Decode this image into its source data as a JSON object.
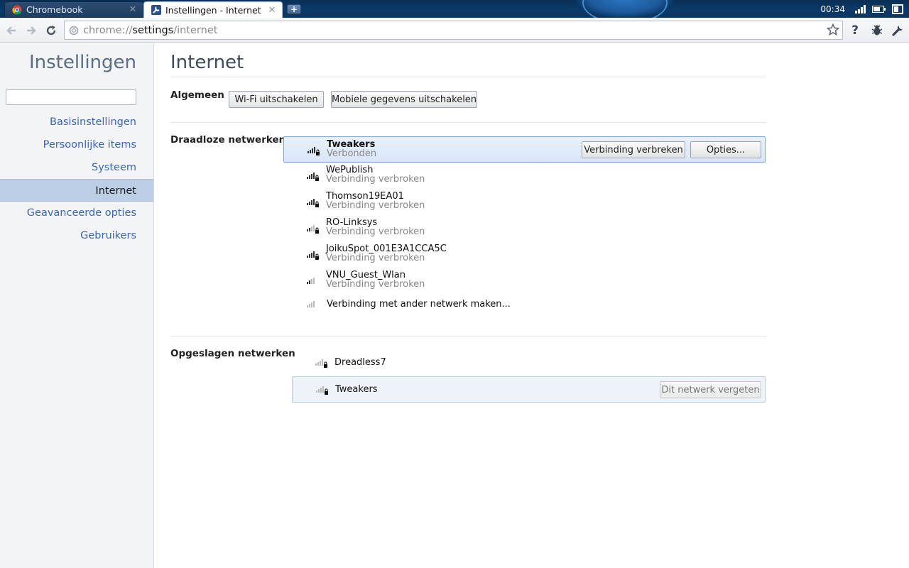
{
  "tabs": [
    {
      "title": "Chromebook",
      "active": false
    },
    {
      "title": "Instellingen - Internet",
      "active": true
    }
  ],
  "tray": {
    "clock": "00:34"
  },
  "omnibox": {
    "scheme": "chrome://",
    "host": "settings",
    "path": "/internet"
  },
  "sidebar": {
    "title": "Instellingen",
    "search_placeholder": "",
    "items": [
      {
        "label": "Basisinstellingen",
        "selected": false
      },
      {
        "label": "Persoonlijke items",
        "selected": false
      },
      {
        "label": "Systeem",
        "selected": false
      },
      {
        "label": "Internet",
        "selected": true
      },
      {
        "label": "Geavanceerde opties",
        "selected": false
      },
      {
        "label": "Gebruikers",
        "selected": false
      }
    ]
  },
  "main": {
    "title": "Internet",
    "general": {
      "label": "Algemeen",
      "wifi_off": "Wi-Fi uitschakelen",
      "mobile_off": "Mobiele gegevens uitschakelen"
    },
    "wireless": {
      "label": "Draadloze netwerken",
      "disconnect_label": "Verbinding verbreken",
      "options_label": "Opties...",
      "networks": [
        {
          "name": "Tweakers",
          "status": "Verbonden",
          "secured": true,
          "bars": 4
        },
        {
          "name": "WePublish",
          "status": "Verbinding verbroken",
          "secured": true,
          "bars": 4
        },
        {
          "name": "Thomson19EA01",
          "status": "Verbinding verbroken",
          "secured": true,
          "bars": 4
        },
        {
          "name": "RO-Linksys",
          "status": "Verbinding verbroken",
          "secured": true,
          "bars": 2
        },
        {
          "name": "JoikuSpot_001E3A1CCA5C",
          "status": "Verbinding verbroken",
          "secured": true,
          "bars": 4
        },
        {
          "name": "VNU_Guest_Wlan",
          "status": "Verbinding verbroken",
          "secured": false,
          "bars": 2
        }
      ],
      "other_network": "Verbinding met ander netwerk maken..."
    },
    "saved": {
      "label": "Opgeslagen netwerken",
      "forget_label": "Dit netwerk vergeten",
      "networks": [
        {
          "name": "Dreadless7"
        },
        {
          "name": "Tweakers"
        }
      ]
    }
  },
  "colors": {
    "accent": "#3a67b6",
    "sidebar_selected": "#bccde6",
    "selected_row_border": "#7da5dd"
  }
}
